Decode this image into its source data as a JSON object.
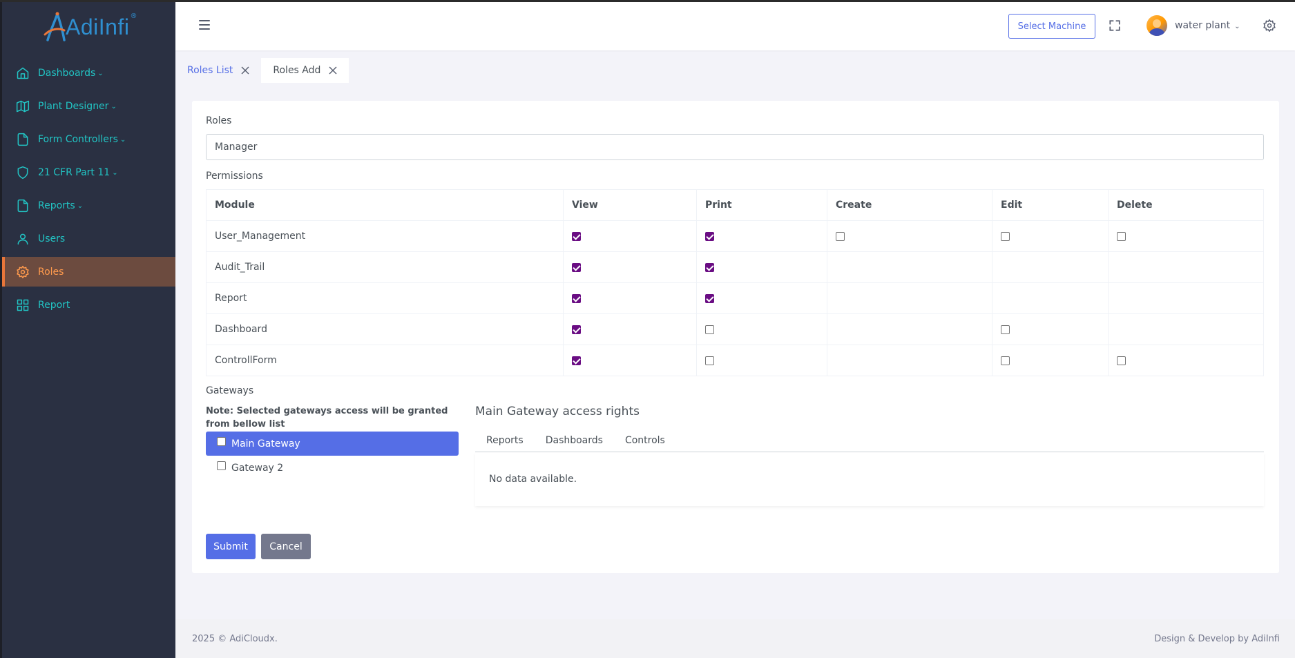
{
  "logo": {
    "text": "AdiInfi",
    "reg": "®"
  },
  "sidebar": {
    "items": [
      {
        "label": "Dashboards",
        "icon": "home-icon",
        "chevron": true
      },
      {
        "label": "Plant Designer",
        "icon": "map-icon",
        "chevron": true
      },
      {
        "label": "Form Controllers",
        "icon": "file-icon",
        "chevron": true
      },
      {
        "label": "21 CFR Part 11",
        "icon": "shield-icon",
        "chevron": true
      },
      {
        "label": "Reports",
        "icon": "file-icon",
        "chevron": true
      },
      {
        "label": "Users",
        "icon": "user-icon",
        "chevron": false
      },
      {
        "label": "Roles",
        "icon": "gear-icon",
        "chevron": false,
        "active": true
      },
      {
        "label": "Report",
        "icon": "grid-icon",
        "chevron": false
      }
    ]
  },
  "header": {
    "select_machine": "Select Machine",
    "user_name": "water plant"
  },
  "tabs": [
    {
      "label": "Roles List",
      "active": false
    },
    {
      "label": "Roles Add",
      "active": true
    }
  ],
  "form": {
    "roles_label": "Roles",
    "roles_value": "Manager",
    "permissions_label": "Permissions",
    "columns": [
      "Module",
      "View",
      "Print",
      "Create",
      "Edit",
      "Delete"
    ],
    "rows": [
      {
        "module": "User_Management",
        "cells": [
          true,
          true,
          false,
          false,
          false
        ]
      },
      {
        "module": "Audit_Trail",
        "cells": [
          true,
          true,
          null,
          null,
          null
        ]
      },
      {
        "module": "Report",
        "cells": [
          true,
          true,
          null,
          null,
          null
        ]
      },
      {
        "module": "Dashboard",
        "cells": [
          true,
          false,
          null,
          false,
          null
        ]
      },
      {
        "module": "ControllForm",
        "cells": [
          true,
          false,
          null,
          false,
          false
        ]
      }
    ],
    "gateways_label": "Gateways",
    "gateways_note": "Note: Selected gateways access will be granted from bellow list",
    "gateways": [
      {
        "label": "Main Gateway",
        "selected": true,
        "checked": false
      },
      {
        "label": "Gateway 2",
        "selected": false,
        "checked": false
      }
    ],
    "access_title": "Main Gateway access rights",
    "access_tabs": [
      "Reports",
      "Dashboards",
      "Controls"
    ],
    "no_data": "No data available.",
    "submit": "Submit",
    "cancel": "Cancel"
  },
  "footer": {
    "left": "2025 © AdiCloudx.",
    "right": "Design & Develop by AdiInfi"
  },
  "colors": {
    "sidebar_bg": "#2a3042",
    "sidebar_text": "#22c4c4",
    "active_item": "#ff9a4d",
    "primary": "#556ee6",
    "checkbox_checked": "#6a0d83",
    "cancel": "#74788d"
  }
}
